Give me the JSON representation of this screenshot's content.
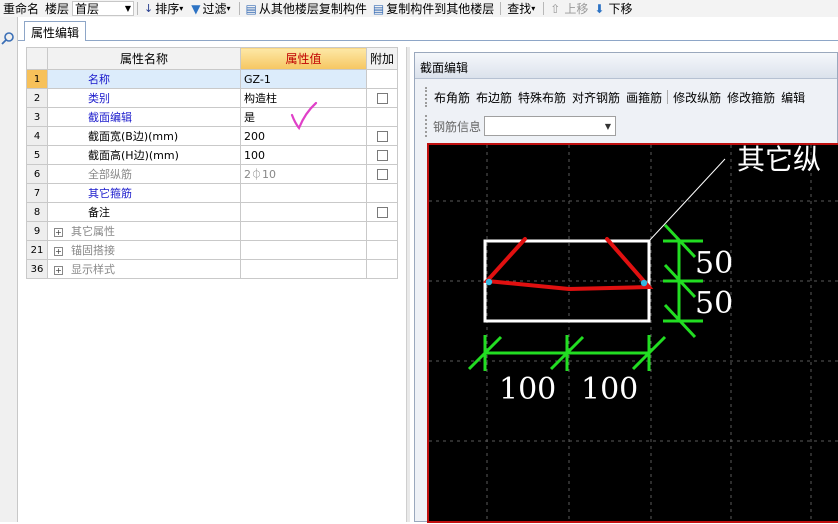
{
  "toolbar": {
    "rename": "重命名",
    "floor_label": "楼层",
    "floor_value": "首层",
    "sort": "排序",
    "filter": "过滤",
    "copy_from": "从其他楼层复制构件",
    "copy_to": "复制构件到其他楼层",
    "find": "查找",
    "move_up": "上移",
    "move_down": "下移"
  },
  "tabs": [
    {
      "label": "属性编辑"
    }
  ],
  "grid": {
    "headers": {
      "name": "属性名称",
      "value": "属性值",
      "extra": "附加"
    },
    "rows": [
      {
        "idx": "1",
        "name": "名称",
        "value": "GZ-1"
      },
      {
        "idx": "2",
        "name": "类别",
        "value": "构造柱"
      },
      {
        "idx": "3",
        "name": "截面编辑",
        "value": "是"
      },
      {
        "idx": "4",
        "name": "截面宽(B边)(mm)",
        "value": "200"
      },
      {
        "idx": "5",
        "name": "截面高(H边)(mm)",
        "value": "100"
      },
      {
        "idx": "6",
        "name": "全部纵筋",
        "value": "2⏀10"
      },
      {
        "idx": "7",
        "name": "其它箍筋",
        "value": ""
      },
      {
        "idx": "8",
        "name": "备注",
        "value": ""
      },
      {
        "idx": "9",
        "name": "其它属性",
        "value": ""
      },
      {
        "idx": "21",
        "name": "锚固搭接",
        "value": ""
      },
      {
        "idx": "36",
        "name": "显示样式",
        "value": ""
      }
    ]
  },
  "section_panel": {
    "title": "截面编辑",
    "tools": [
      "布角筋",
      "布边筋",
      "特殊布筋",
      "对齐钢筋",
      "画箍筋",
      "修改纵筋",
      "修改箍筋",
      "编辑"
    ],
    "rebar_info_label": "钢筋信息",
    "rebar_info_value": ""
  },
  "drawing": {
    "label_top": "其它纵",
    "dim_right_top": "50",
    "dim_right_bottom": "50",
    "dim_bottom_left": "100",
    "dim_bottom_right": "100"
  },
  "colors": {
    "canvas_bg": "#000000",
    "section_outline": "#ffffff",
    "rebar": "#e01010",
    "dimension": "#22dd22",
    "annotation_check": "#e040c8"
  }
}
